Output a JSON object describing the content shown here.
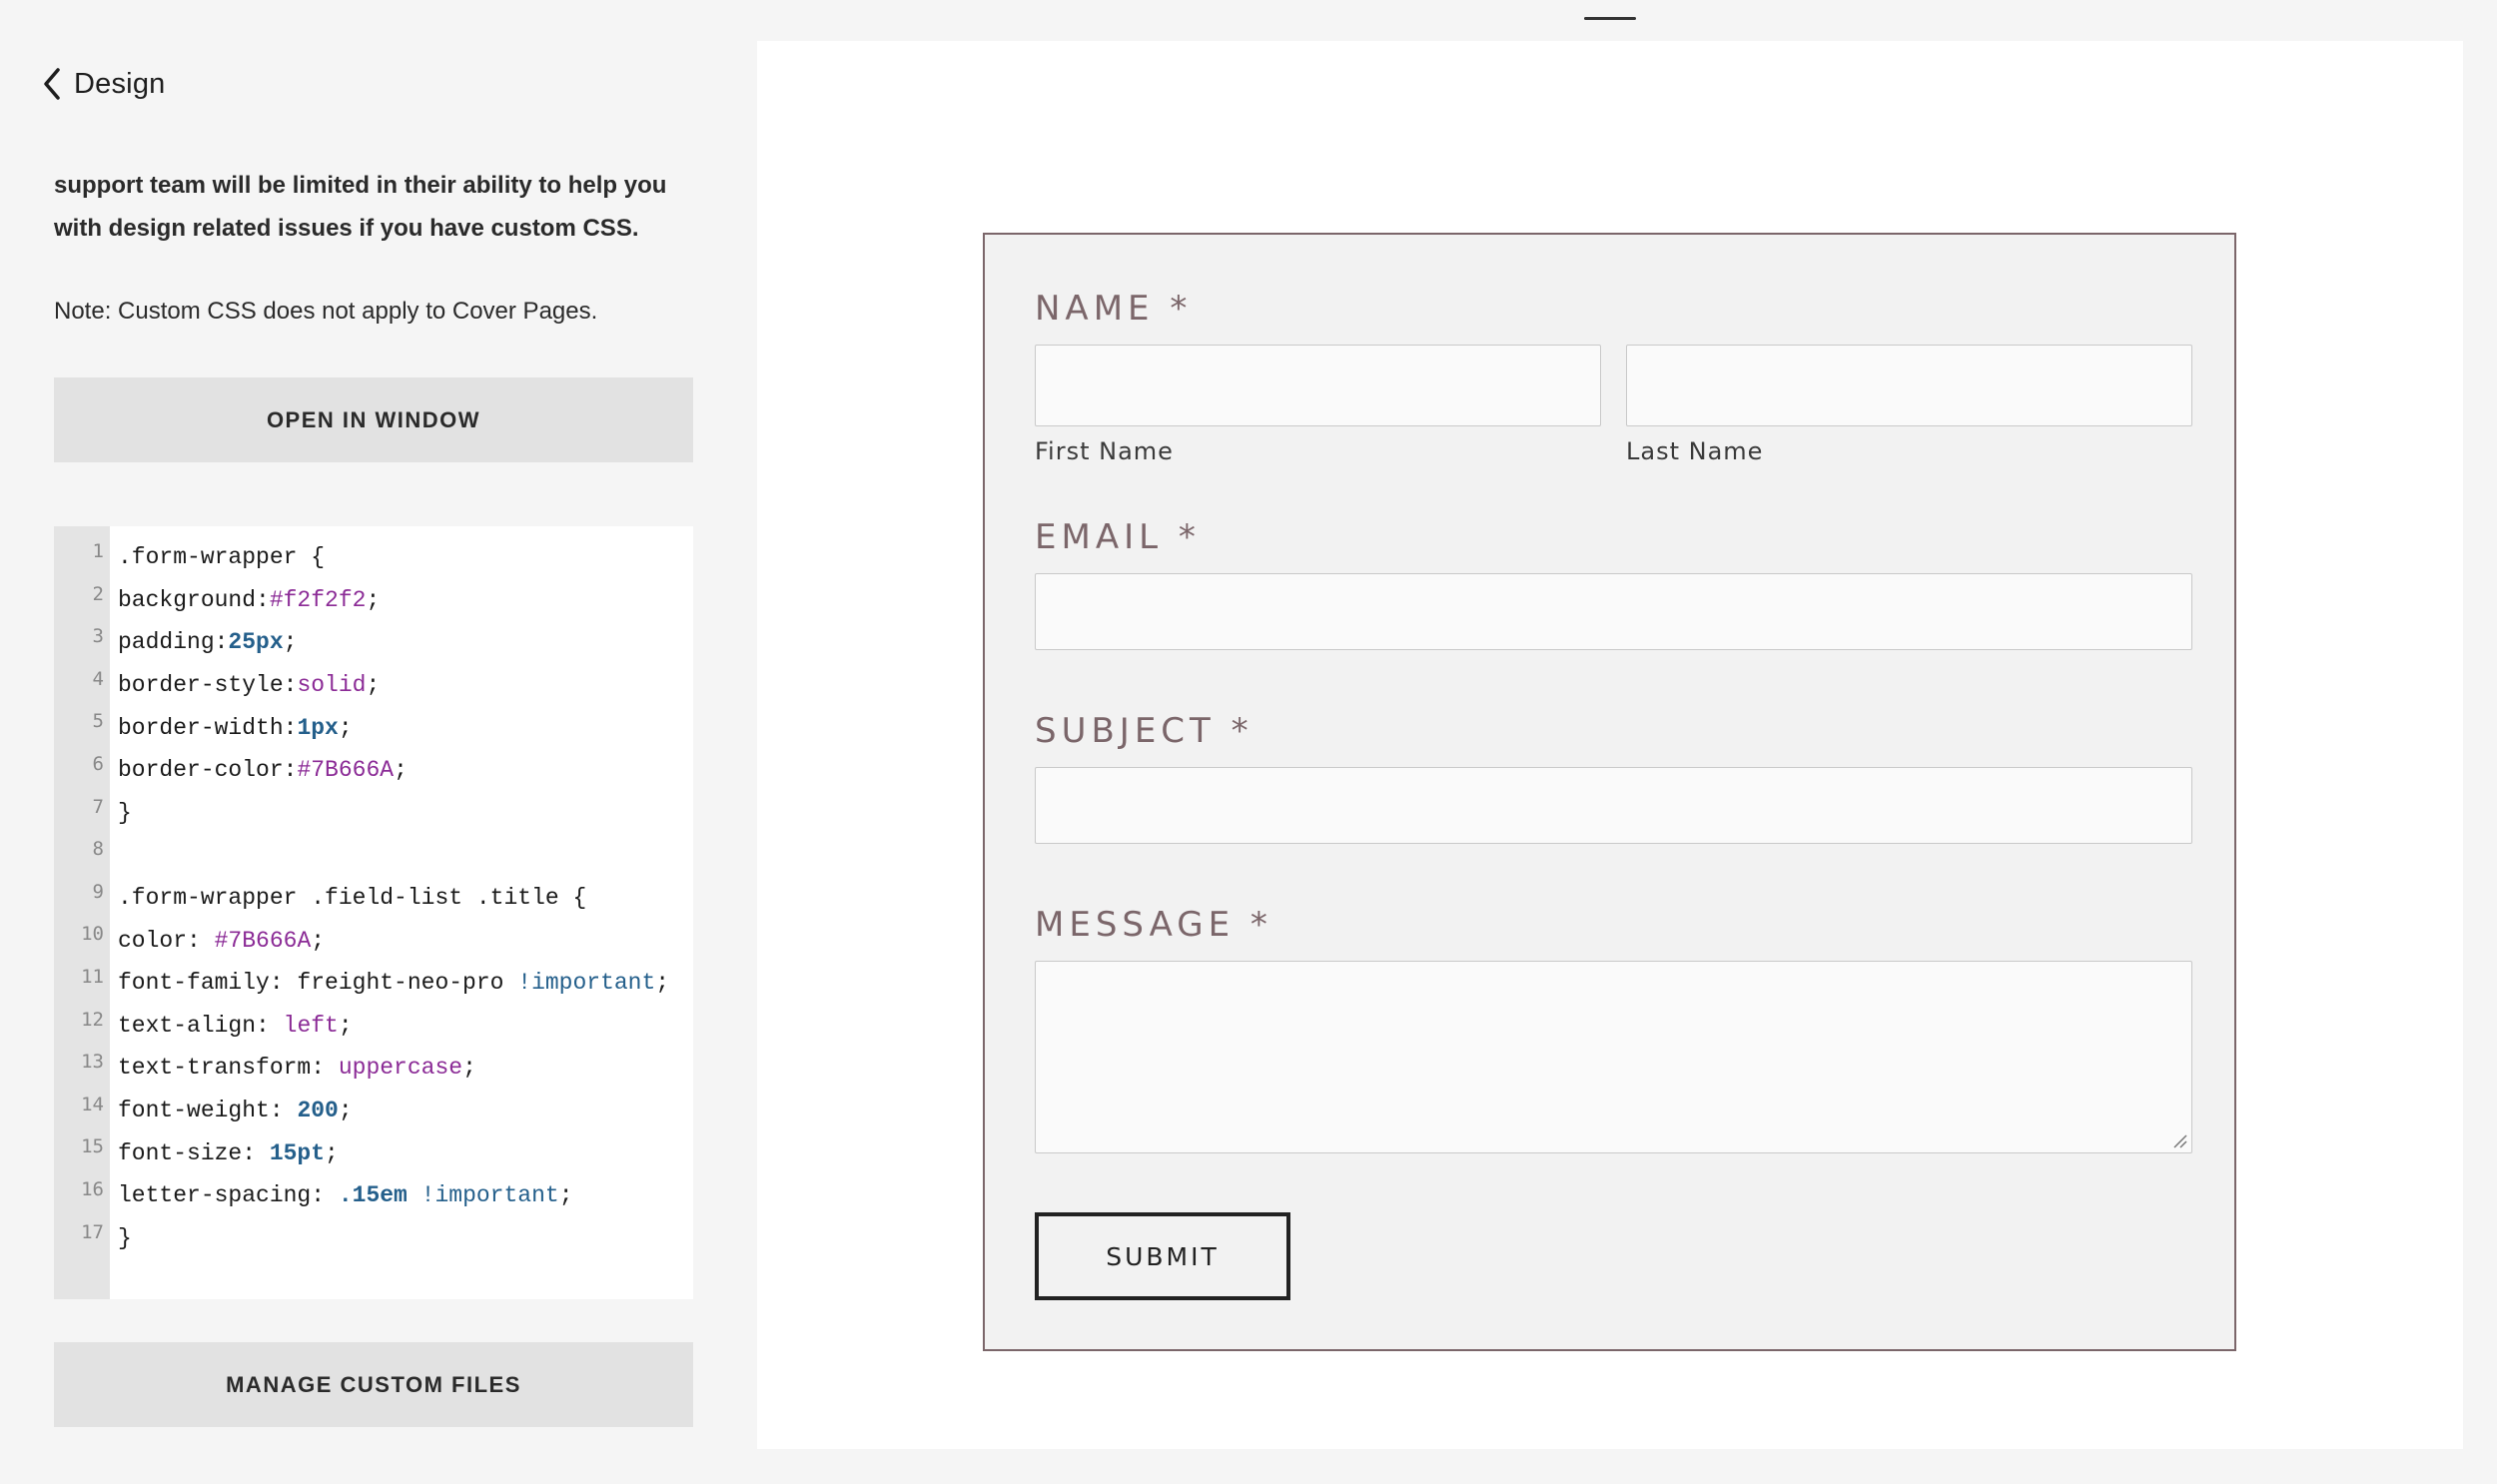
{
  "header": {
    "back_label": "Design"
  },
  "panel": {
    "info_text": "support team will be limited in their ability to help you with design related issues if you have custom CSS.",
    "note_text": "Note: Custom CSS does not apply to Cover Pages.",
    "open_button_label": "OPEN IN WINDOW",
    "manage_button_label": "MANAGE CUSTOM FILES"
  },
  "editor": {
    "line_numbers": [
      "1",
      "2",
      "3",
      "4",
      "5",
      "6",
      "7",
      "8",
      "9",
      "10",
      "11",
      "12",
      "13",
      "14",
      "15",
      "16",
      "17"
    ],
    "lines": [
      [
        {
          "t": ".form-wrapper {",
          "c": ""
        }
      ],
      [
        {
          "t": "background:",
          "c": ""
        },
        {
          "t": "#f2f2f2",
          "c": "purple"
        },
        {
          "t": ";",
          "c": ""
        }
      ],
      [
        {
          "t": "padding:",
          "c": ""
        },
        {
          "t": "25px",
          "c": "blue"
        },
        {
          "t": ";",
          "c": ""
        }
      ],
      [
        {
          "t": "border-style:",
          "c": ""
        },
        {
          "t": "solid",
          "c": "purple"
        },
        {
          "t": ";",
          "c": ""
        }
      ],
      [
        {
          "t": "border-width:",
          "c": ""
        },
        {
          "t": "1px",
          "c": "blue"
        },
        {
          "t": ";",
          "c": ""
        }
      ],
      [
        {
          "t": "border-color:",
          "c": ""
        },
        {
          "t": "#7B666A",
          "c": "purple"
        },
        {
          "t": ";",
          "c": ""
        }
      ],
      [
        {
          "t": "}",
          "c": ""
        }
      ],
      [
        {
          "t": "",
          "c": ""
        }
      ],
      [
        {
          "t": ".form-wrapper .field-list .title {",
          "c": ""
        }
      ],
      [
        {
          "t": "color: ",
          "c": ""
        },
        {
          "t": "#7B666A",
          "c": "purple"
        },
        {
          "t": ";",
          "c": ""
        }
      ],
      [
        {
          "t": "font-family: freight-neo-pro ",
          "c": ""
        },
        {
          "t": "!important",
          "c": "blue2"
        },
        {
          "t": ";",
          "c": ""
        }
      ],
      [
        {
          "t": "text-align: ",
          "c": ""
        },
        {
          "t": "left",
          "c": "purple"
        },
        {
          "t": ";",
          "c": ""
        }
      ],
      [
        {
          "t": "text-transform: ",
          "c": ""
        },
        {
          "t": "uppercase",
          "c": "purple"
        },
        {
          "t": ";",
          "c": ""
        }
      ],
      [
        {
          "t": "font-weight: ",
          "c": ""
        },
        {
          "t": "200",
          "c": "blue"
        },
        {
          "t": ";",
          "c": ""
        }
      ],
      [
        {
          "t": "font-size: ",
          "c": ""
        },
        {
          "t": "15pt",
          "c": "blue"
        },
        {
          "t": ";",
          "c": ""
        }
      ],
      [
        {
          "t": "letter-spacing: ",
          "c": ""
        },
        {
          "t": ".15em",
          "c": "blue"
        },
        {
          "t": " ",
          "c": ""
        },
        {
          "t": "!important",
          "c": "blue2"
        },
        {
          "t": ";",
          "c": ""
        }
      ],
      [
        {
          "t": "}",
          "c": ""
        }
      ]
    ]
  },
  "form": {
    "name_title": "NAME *",
    "first_name_label": "First Name",
    "last_name_label": "Last Name",
    "email_title": "EMAIL *",
    "subject_title": "SUBJECT *",
    "message_title": "MESSAGE *",
    "submit_label": "SUBMIT"
  },
  "colors": {
    "form_background": "#f2f2f2",
    "form_border": "#7B666A",
    "title_color": "#7B666A",
    "panel_background": "#f5f5f5",
    "button_background": "#e2e2e2"
  },
  "icons": {
    "back": "chevron-left-icon",
    "resize": "resize-grip-icon"
  }
}
